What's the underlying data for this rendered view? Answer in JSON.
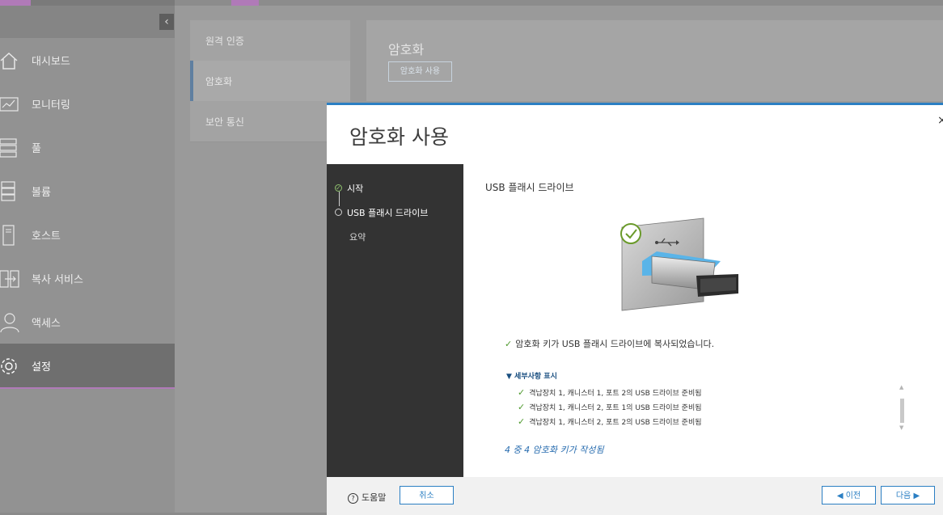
{
  "sidebar": {
    "collapse_icon": "chevron-left-icon",
    "items": [
      {
        "label": "대시보드",
        "icon": "home-icon"
      },
      {
        "label": "모니터링",
        "icon": "monitor-chart-icon"
      },
      {
        "label": "풀",
        "icon": "pool-icon"
      },
      {
        "label": "볼륨",
        "icon": "volume-icon"
      },
      {
        "label": "호스트",
        "icon": "host-icon"
      },
      {
        "label": "복사 서비스",
        "icon": "copy-service-icon"
      },
      {
        "label": "액세스",
        "icon": "user-icon"
      },
      {
        "label": "설정",
        "icon": "gear-icon",
        "active": true
      }
    ]
  },
  "subnav": {
    "items": [
      {
        "label": "원격 인증"
      },
      {
        "label": "암호화",
        "active": true
      },
      {
        "label": "보안 통신"
      }
    ]
  },
  "content": {
    "title": "암호화",
    "enable_button": "암호화 사용"
  },
  "modal": {
    "title": "암호화 사용",
    "close": "×",
    "steps": [
      {
        "label": "시작",
        "status": "done"
      },
      {
        "label": "USB 플래시 드라이브",
        "status": "current"
      },
      {
        "label": "요약",
        "status": "pending"
      }
    ],
    "step_heading": "USB 플래시 드라이브",
    "success_message": "암호화 키가 USB 플래시 드라이브에 복사되었습니다.",
    "details_toggle": "▼ 세부사항 표시",
    "details": [
      "격납장치 1, 캐니스터 1, 포트 2의 USB 드라이브 준비됨",
      "격납장치 1, 캐니스터 2, 포트 1의 USB 드라이브 준비됨",
      "격납장치 1, 캐니스터 2, 포트 2의 USB 드라이브 준비됨"
    ],
    "progress_text": "4 중 4 암호화 키가 작성됨",
    "footer": {
      "help": "도움말",
      "cancel": "취소",
      "previous": "◀ 이전",
      "next": "다음 ▶"
    }
  },
  "colors": {
    "accent_blue": "#2b7fc3",
    "accent_purple": "#b07ab8",
    "success_green": "#4f9a2e",
    "step_panel": "#333333"
  }
}
